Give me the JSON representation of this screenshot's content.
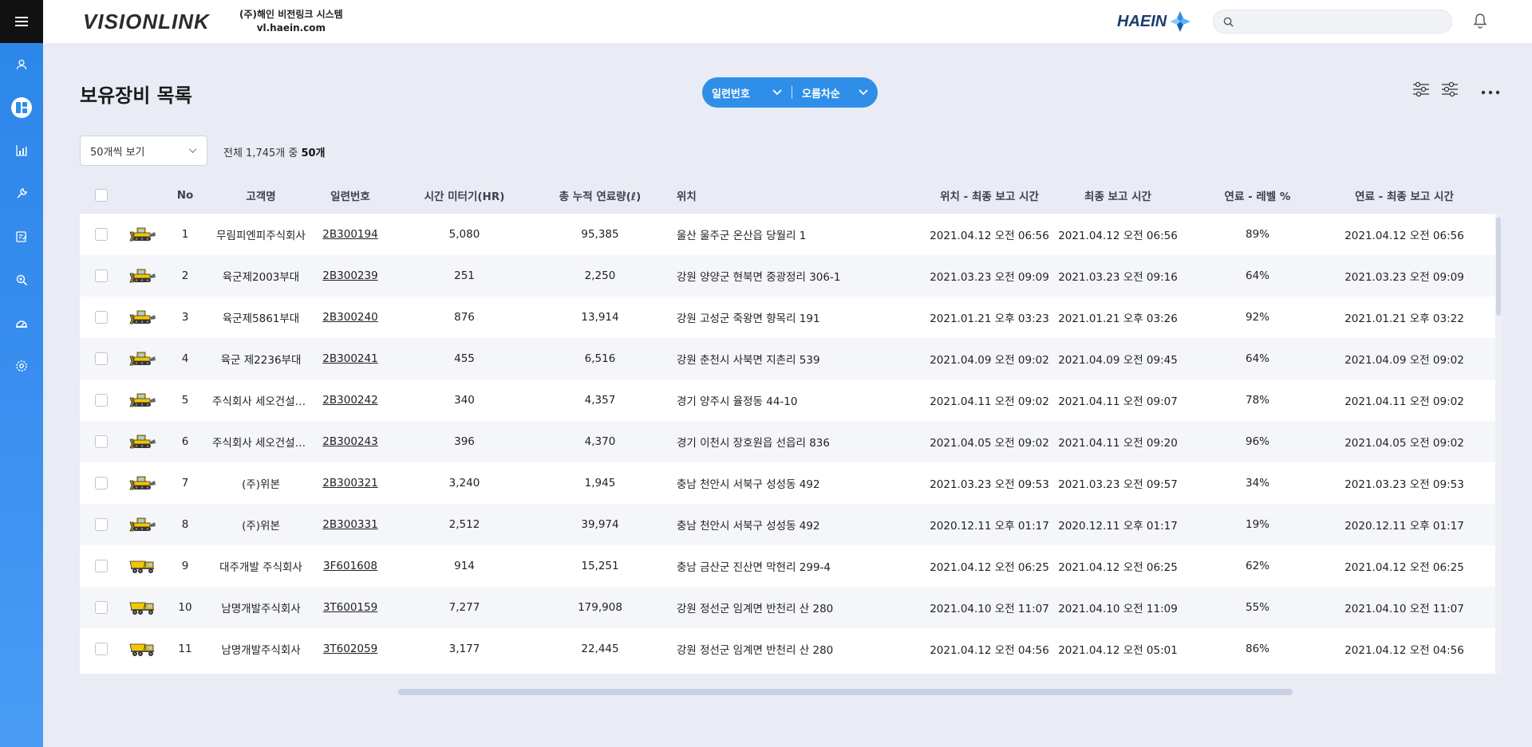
{
  "header": {
    "logo": "VISIONLINK",
    "company_name": "(주)해인 비전링크 시스템",
    "company_url": "vl.haein.com",
    "brand": "HAEIN",
    "search_placeholder": ""
  },
  "sidebar": {
    "items": [
      {
        "icon": "user-icon"
      },
      {
        "icon": "dashboard-icon",
        "active": true
      },
      {
        "icon": "chart-icon"
      },
      {
        "icon": "wrench-icon"
      },
      {
        "icon": "report-icon"
      },
      {
        "icon": "search-doc-icon"
      },
      {
        "icon": "gauge-icon"
      },
      {
        "icon": "settings-icon"
      }
    ]
  },
  "page": {
    "title": "보유장비 목록",
    "sort_field": "일련번호",
    "sort_order": "오름차순",
    "page_size": "50개씩 보기",
    "total_prefix": "전체 1,745개 중 ",
    "total_shown": "50개"
  },
  "table": {
    "columns": {
      "no": "No",
      "customer": "고객명",
      "serial": "일련번호",
      "hours": "시간 미터기(HR)",
      "fuel_total": "총 누적 연료량(ℓ)",
      "location": "위치",
      "loc_time": "위치 - 최종 보고 시간",
      "last_time": "최종 보고 시간",
      "fuel_level": "연료 - 레벨 %",
      "fuel_time": "연료 - 최종 보고 시간"
    },
    "rows": [
      {
        "no": "1",
        "type": "dozer",
        "customer": "무림피엔피주식회사",
        "serial": "2B300194",
        "hours": "5,080",
        "fuel": "95,385",
        "location": "울산 울주군 온산읍 당월리 1",
        "loc_time": "2021.04.12 오전 06:56",
        "last_time": "2021.04.12 오전 06:56",
        "fuel_pct": "89%",
        "fuel_time": "2021.04.12 오전 06:56"
      },
      {
        "no": "2",
        "type": "dozer",
        "customer": "육군제2003부대",
        "serial": "2B300239",
        "hours": "251",
        "fuel": "2,250",
        "location": "강원 양양군 현북면 중광정리 306-1",
        "loc_time": "2021.03.23 오전 09:09",
        "last_time": "2021.03.23 오전 09:16",
        "fuel_pct": "64%",
        "fuel_time": "2021.03.23 오전 09:09"
      },
      {
        "no": "3",
        "type": "dozer",
        "customer": "육군제5861부대",
        "serial": "2B300240",
        "hours": "876",
        "fuel": "13,914",
        "location": "강원 고성군 죽왕면 향목리 191",
        "loc_time": "2021.01.21 오후 03:23",
        "last_time": "2021.01.21 오후 03:26",
        "fuel_pct": "92%",
        "fuel_time": "2021.01.21 오후 03:22"
      },
      {
        "no": "4",
        "type": "dozer",
        "customer": "육군 제2236부대",
        "serial": "2B300241",
        "hours": "455",
        "fuel": "6,516",
        "location": "강원 춘천시 사북면 지촌리 539",
        "loc_time": "2021.04.09 오전 09:02",
        "last_time": "2021.04.09 오전 09:45",
        "fuel_pct": "64%",
        "fuel_time": "2021.04.09 오전 09:02"
      },
      {
        "no": "5",
        "type": "dozer",
        "customer": "주식회사 세오건설장비",
        "serial": "2B300242",
        "hours": "340",
        "fuel": "4,357",
        "location": "경기 양주시 율정동 44-10",
        "loc_time": "2021.04.11 오전 09:02",
        "last_time": "2021.04.11 오전 09:07",
        "fuel_pct": "78%",
        "fuel_time": "2021.04.11 오전 09:02"
      },
      {
        "no": "6",
        "type": "dozer",
        "customer": "주식회사 세오건설장비",
        "serial": "2B300243",
        "hours": "396",
        "fuel": "4,370",
        "location": "경기 이천시 장호원읍 선읍리 836",
        "loc_time": "2021.04.05 오전 09:02",
        "last_time": "2021.04.11 오전 09:20",
        "fuel_pct": "96%",
        "fuel_time": "2021.04.05 오전 09:02"
      },
      {
        "no": "7",
        "type": "dozer",
        "customer": "(주)위본",
        "serial": "2B300321",
        "hours": "3,240",
        "fuel": "1,945",
        "location": "충남 천안시 서북구 성성동 492",
        "loc_time": "2021.03.23 오전 09:53",
        "last_time": "2021.03.23 오전 09:57",
        "fuel_pct": "34%",
        "fuel_time": "2021.03.23 오전 09:53"
      },
      {
        "no": "8",
        "type": "dozer",
        "customer": "(주)위본",
        "serial": "2B300331",
        "hours": "2,512",
        "fuel": "39,974",
        "location": "충남 천안시 서북구 성성동 492",
        "loc_time": "2020.12.11 오후 01:17",
        "last_time": "2020.12.11 오후 01:17",
        "fuel_pct": "19%",
        "fuel_time": "2020.12.11 오후 01:17"
      },
      {
        "no": "9",
        "type": "truck",
        "customer": "대주개발 주식회사",
        "serial": "3F601608",
        "hours": "914",
        "fuel": "15,251",
        "location": "충남 금산군 진산면 막현리 299-4",
        "loc_time": "2021.04.12 오전 06:25",
        "last_time": "2021.04.12 오전 06:25",
        "fuel_pct": "62%",
        "fuel_time": "2021.04.12 오전 06:25"
      },
      {
        "no": "10",
        "type": "truck",
        "customer": "남명개발주식회사",
        "serial": "3T600159",
        "hours": "7,277",
        "fuel": "179,908",
        "location": "강원 정선군 임계면 반천리 산 280",
        "loc_time": "2021.04.10 오전 11:07",
        "last_time": "2021.04.10 오전 11:09",
        "fuel_pct": "55%",
        "fuel_time": "2021.04.10 오전 11:07"
      },
      {
        "no": "11",
        "type": "truck",
        "customer": "남명개발주식회사",
        "serial": "3T602059",
        "hours": "3,177",
        "fuel": "22,445",
        "location": "강원 정선군 임계면 반천리 산 280",
        "loc_time": "2021.04.12 오전 04:56",
        "last_time": "2021.04.12 오전 05:01",
        "fuel_pct": "86%",
        "fuel_time": "2021.04.12 오전 04:56"
      }
    ]
  }
}
